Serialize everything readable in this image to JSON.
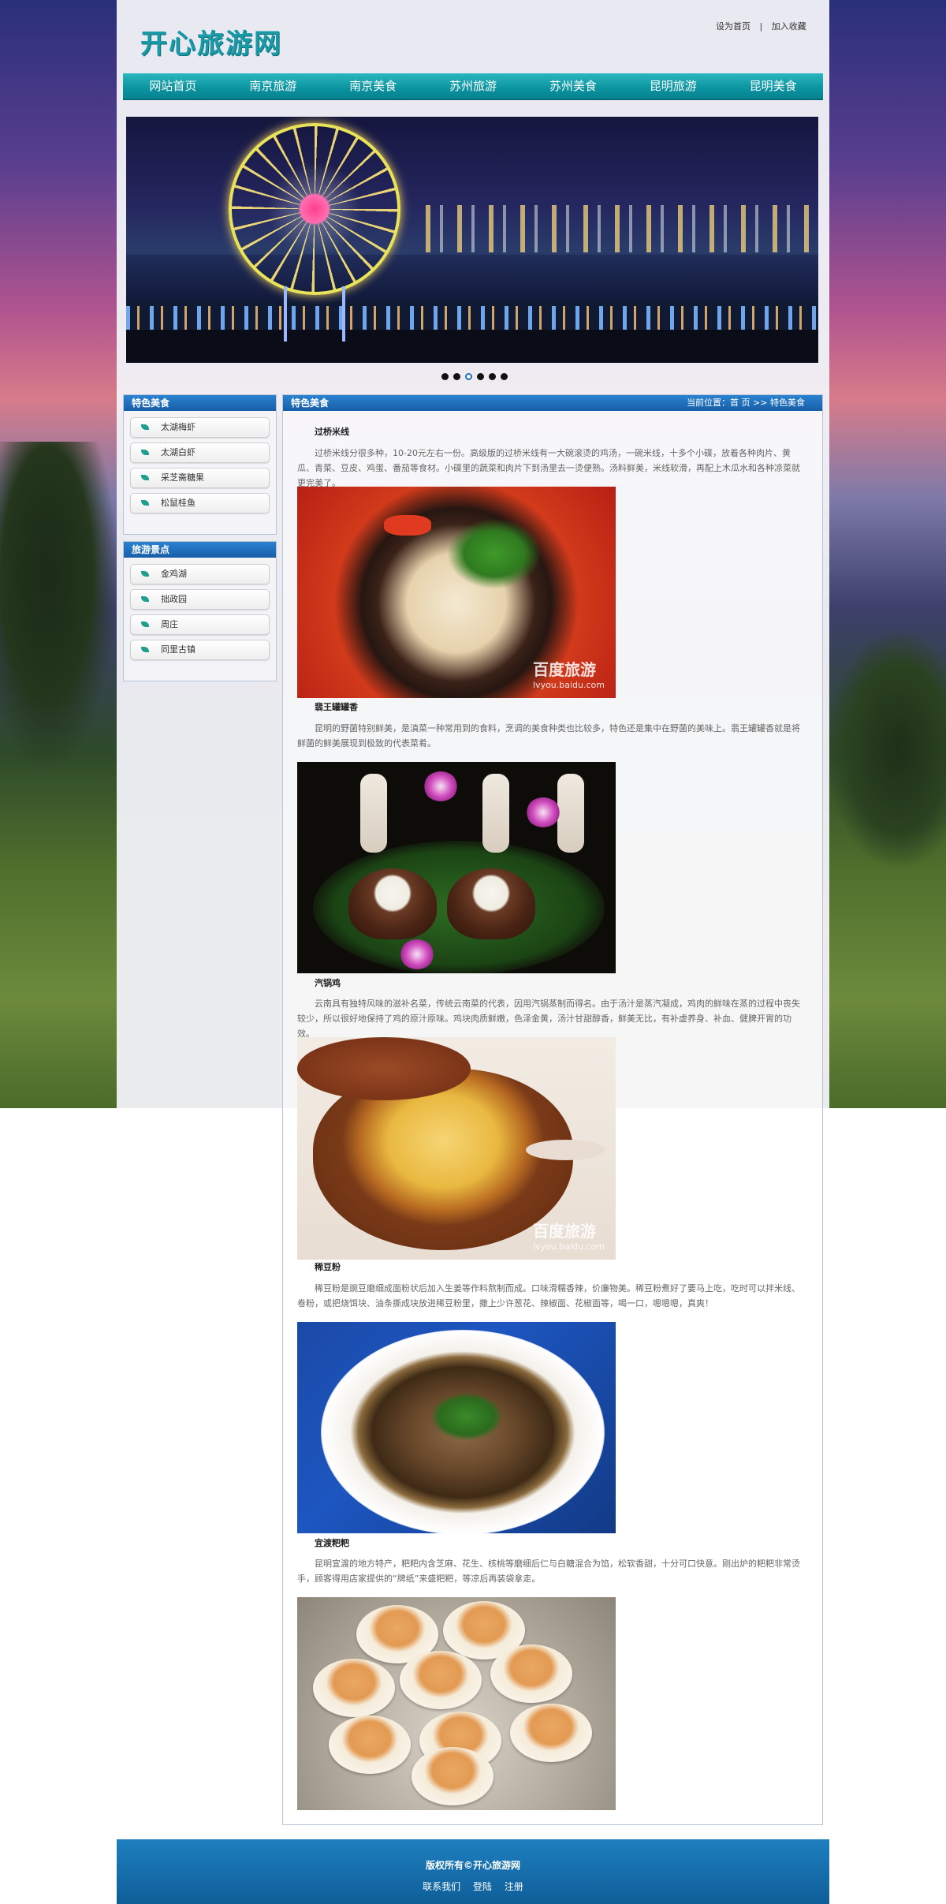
{
  "site": {
    "logo": "开心旅游网"
  },
  "top_links": {
    "set_home": "设为首页",
    "separator": "|",
    "favorite": "加入收藏"
  },
  "nav": [
    "网站首页",
    "南京旅游",
    "南京美食",
    "苏州旅游",
    "苏州美食",
    "昆明旅游",
    "昆明美食"
  ],
  "banner": {
    "slides": 6,
    "active_index": 2
  },
  "sidebar": {
    "food": {
      "title": "特色美食",
      "items": [
        "太湖梅虾",
        "太湖白虾",
        "采芝斋糖果",
        "松鼠桂鱼"
      ]
    },
    "scenic": {
      "title": "旅游景点",
      "items": [
        "金鸡湖",
        "拙政园",
        "周庄",
        "同里古镇"
      ]
    }
  },
  "main": {
    "title": "特色美食",
    "breadcrumb": "当前位置：首 页 >> 特色美食",
    "foods": [
      {
        "name": "过桥米线",
        "desc": "过桥米线分很多种，10-20元左右一份。高级版的过桥米线有一大碗滚烫的鸡汤，一碗米线，十多个小碟，放着各种肉片、黄瓜、青菜、豆皮、鸡蛋、番茄等食材。小碟里的蔬菜和肉片下到汤里去一烫便熟。汤料鲜美，米线软滑，再配上木瓜水和各种凉菜就更完美了。"
      },
      {
        "name": "翡王罐罐香",
        "desc": "昆明的野菌特别鲜美，是滇菜一种常用到的食料，烹调的美食种类也比较多，特色还是集中在野菌的美味上。翡王罐罐香就是将鲜菌的鲜美展现到极致的代表菜肴。"
      },
      {
        "name": "汽锅鸡",
        "desc": "云南具有独特风味的滋补名菜，传统云南菜的代表，因用汽锅蒸制而得名。由于汤汁是蒸汽凝成，鸡肉的鲜味在蒸的过程中丧失较少，所以很好地保持了鸡的原汁原味。鸡块肉质鲜嫩，色泽金黄，汤汁甘甜醇香，鲜美无比，有补虚养身、补血、健脾开胃的功效。"
      },
      {
        "name": "稀豆粉",
        "desc": "稀豆粉是豌豆磨细成面粉状后加入生姜等作料熬制而成。口味滑糯香辣，价廉物美。稀豆粉煮好了要马上吃，吃时可以拌米线、卷粉，或把烧饵块、油条撕成块放进稀豆粉里，撒上少许葱花、辣椒面、花椒面等，喝一口，嗯嗯嗯，真爽！"
      },
      {
        "name": "宜渡粑粑",
        "desc": "昆明宜渡的地方特产，粑粑内含芝麻、花生、核桃等磨细后仁与白糖混合为馅，松软香甜，十分可口快意。刚出炉的粑粑非常烫手，顾客得用店家提供的“牌纸”来盛粑粑，等凉后再装袋拿走。"
      }
    ],
    "watermark": {
      "brand": "百度旅游",
      "url": "lvyou.baidu.com"
    }
  },
  "footer": {
    "copyright": "版权所有©开心旅游网",
    "links": [
      "联系我们",
      "登陆",
      "注册"
    ]
  }
}
